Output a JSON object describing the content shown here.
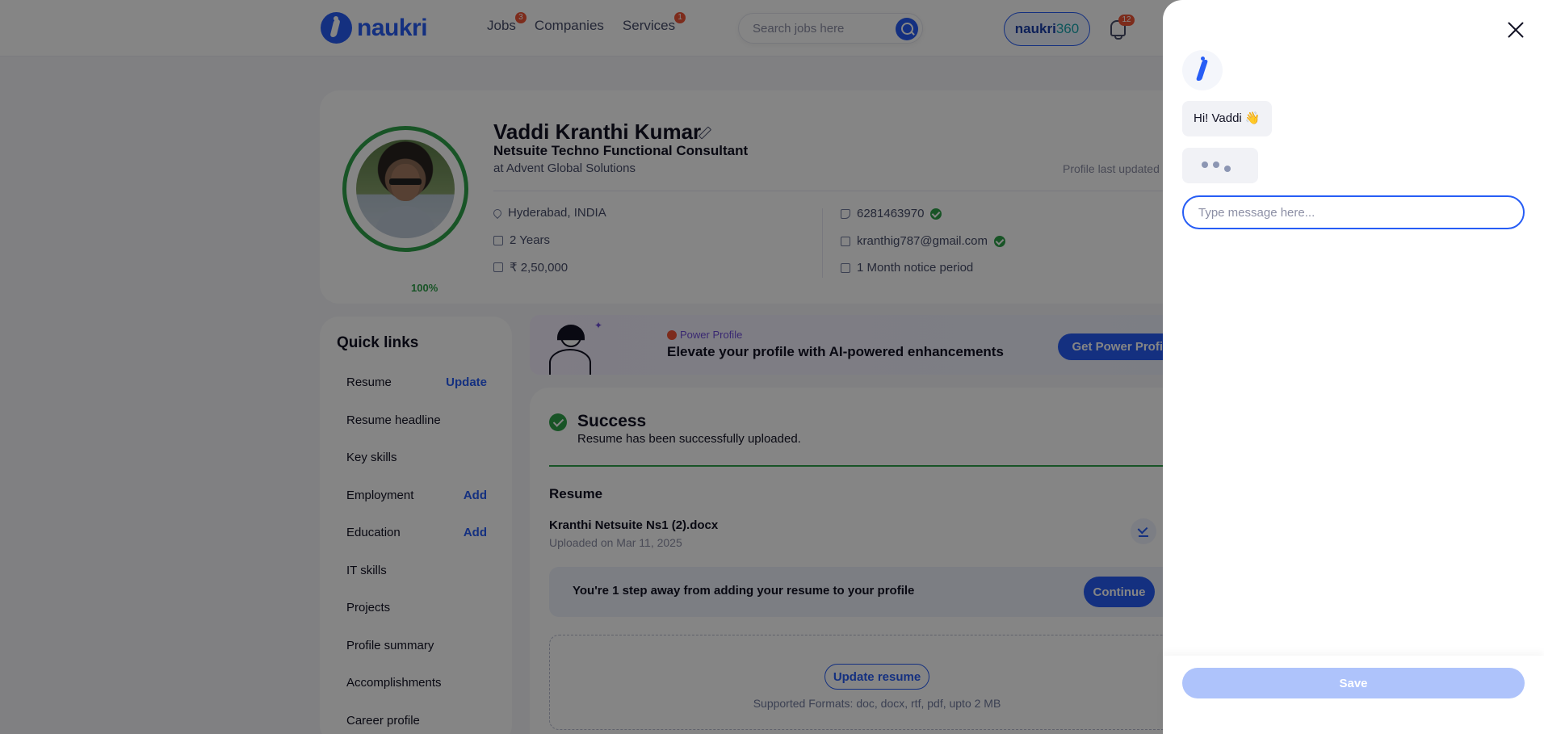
{
  "header": {
    "logo_text": "naukri",
    "nav": [
      {
        "label": "Jobs",
        "badge": "3"
      },
      {
        "label": "Companies",
        "badge": ""
      },
      {
        "label": "Services",
        "badge": "1"
      }
    ],
    "search_placeholder": "Search jobs here",
    "n360_brand": "naukri",
    "n360_suffix": "360",
    "notification_count": "12"
  },
  "profile": {
    "completion": "100%",
    "completion_fraction": 1.0,
    "name": "Vaddi Kranthi Kumar",
    "designation": "Netsuite Techno Functional Consultant",
    "company": "at Advent Global Solutions",
    "last_updated_label": "Profile last updated",
    "location": "Hyderabad, INDIA",
    "experience": "2 Years",
    "salary": "₹ 2,50,000",
    "phone": "6281463970",
    "email": "kranthig787@gmail.com",
    "notice_period": "1 Month notice period"
  },
  "quick_links": {
    "title": "Quick links",
    "items": [
      {
        "label": "Resume",
        "action": "Update"
      },
      {
        "label": "Resume headline",
        "action": ""
      },
      {
        "label": "Key skills",
        "action": ""
      },
      {
        "label": "Employment",
        "action": "Add"
      },
      {
        "label": "Education",
        "action": "Add"
      },
      {
        "label": "IT skills",
        "action": ""
      },
      {
        "label": "Projects",
        "action": ""
      },
      {
        "label": "Profile summary",
        "action": ""
      },
      {
        "label": "Accomplishments",
        "action": ""
      },
      {
        "label": "Career profile",
        "action": ""
      }
    ]
  },
  "power_profile": {
    "tag": "Power Profile",
    "headline": "Elevate your profile with AI-powered enhancements",
    "button": "Get Power Profile"
  },
  "resume_section": {
    "success_title": "Success",
    "success_message": "Resume has been successfully uploaded.",
    "title": "Resume",
    "file_name": "Kranthi Netsuite Ns1 (2).docx",
    "uploaded_on": "Uploaded on Mar 11, 2025",
    "step_text": "You're 1 step away from adding your resume to your profile",
    "continue_label": "Continue",
    "update_label": "Update resume",
    "formats_hint": "Supported Formats: doc, docx, rtf, pdf, upto 2 MB"
  },
  "chat_drawer": {
    "greeting": "Hi! Vaddi 👋",
    "input_placeholder": "Type message here...",
    "save_label": "Save"
  },
  "colors": {
    "brand": "#275df5",
    "success": "#2fa14a",
    "badge": "#f05537",
    "save_disabled": "#aec3fb"
  }
}
